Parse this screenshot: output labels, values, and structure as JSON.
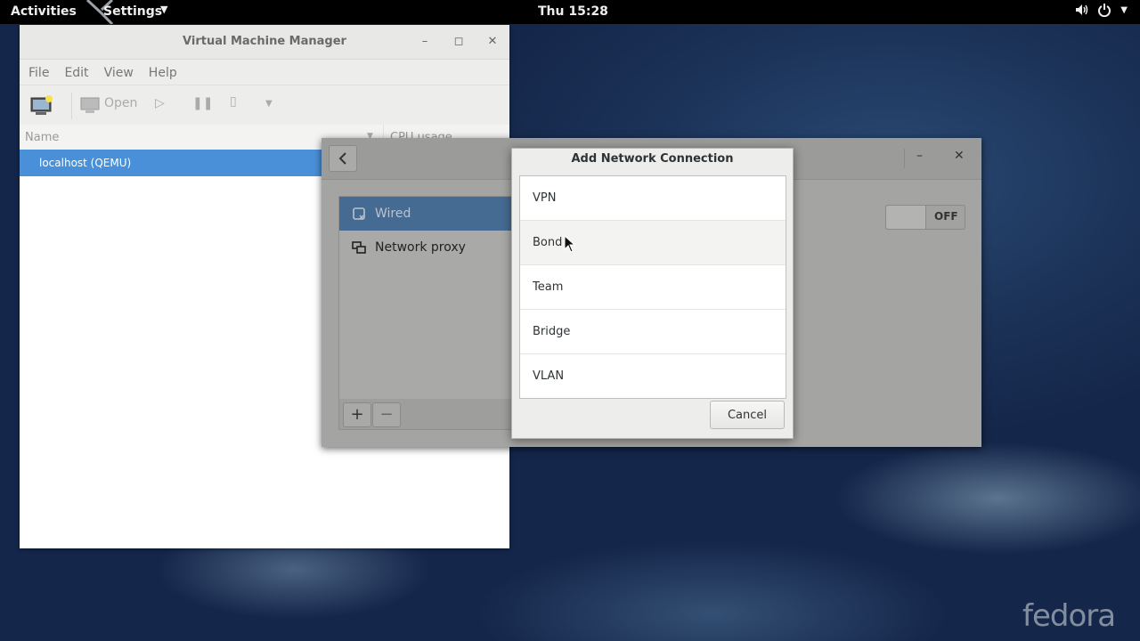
{
  "topbar": {
    "activities": "Activities",
    "app_menu": "Settings",
    "clock": "Thu 15:28",
    "tray_icons": [
      "volume-icon",
      "power-icon"
    ]
  },
  "vmm": {
    "title": "Virtual Machine Manager",
    "menu": [
      "File",
      "Edit",
      "View",
      "Help"
    ],
    "toolbar": {
      "open_label": "Open"
    },
    "columns": {
      "name": "Name",
      "cpu": "CPU usage"
    },
    "rows": [
      {
        "name": "localhost (QEMU)"
      }
    ]
  },
  "settings": {
    "sidebar": [
      {
        "label": "Wired",
        "icon": "wired-network-icon",
        "selected": true
      },
      {
        "label": "Network proxy",
        "icon": "proxy-icon",
        "selected": false
      }
    ],
    "toggle_label": "OFF",
    "add_label": "+",
    "remove_label": "−"
  },
  "dialog": {
    "title": "Add Network Connection",
    "options": [
      "VPN",
      "Bond",
      "Team",
      "Bridge",
      "VLAN"
    ],
    "cancel_label": "Cancel"
  },
  "wallpaper": {
    "brand": "fedora"
  }
}
